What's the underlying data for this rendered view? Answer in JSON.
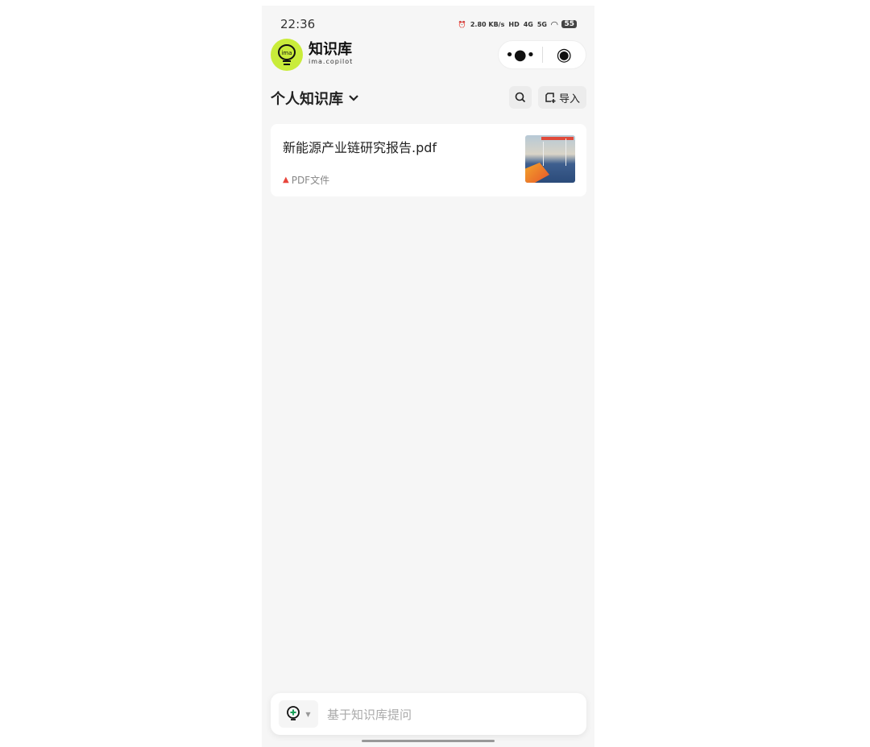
{
  "status_bar": {
    "time": "22:36",
    "net_speed": "2.80 KB/s",
    "hd": "HD",
    "signal_4g": "4G",
    "signal_5g": "5G",
    "battery": "55"
  },
  "header": {
    "app_name": "知识库",
    "app_sub": "ima.copilot",
    "logo_text": "ima"
  },
  "section": {
    "title": "个人知识库",
    "import_label": "导入"
  },
  "files": [
    {
      "name": "新能源产业链研究报告.pdf",
      "type": "PDF文件"
    }
  ],
  "ask_bar": {
    "placeholder": "基于知识库提问"
  },
  "colors": {
    "accent": "#c9ec3a",
    "pdf": "#e8453c"
  }
}
